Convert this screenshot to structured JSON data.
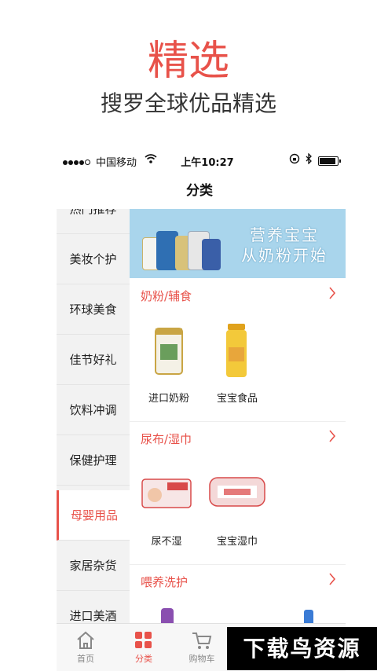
{
  "hero": {
    "title": "精选",
    "subtitle": "搜罗全球优品精选"
  },
  "status_bar": {
    "carrier": "中国移动",
    "time": "上午10:27"
  },
  "nav": {
    "title": "分类"
  },
  "sidebar": {
    "items": [
      {
        "label": "热门推荐"
      },
      {
        "label": "美妆个护"
      },
      {
        "label": "环球美食"
      },
      {
        "label": "佳节好礼"
      },
      {
        "label": "饮料冲调"
      },
      {
        "label": "保健护理"
      },
      {
        "label": "母婴用品",
        "active": true
      },
      {
        "label": "家居杂货"
      },
      {
        "label": "进口美酒"
      }
    ]
  },
  "banner": {
    "line1": "营养宝宝",
    "line2": "从奶粉开始"
  },
  "sections": [
    {
      "title": "奶粉/辅食",
      "products": [
        {
          "label": "进口奶粉"
        },
        {
          "label": "宝宝食品"
        }
      ]
    },
    {
      "title": "尿布/湿巾",
      "products": [
        {
          "label": "尿不湿"
        },
        {
          "label": "宝宝湿巾"
        }
      ]
    },
    {
      "title": "喂养洗护",
      "products": []
    }
  ],
  "tabbar": {
    "tabs": [
      {
        "label": "首页",
        "icon": "home-icon"
      },
      {
        "label": "分类",
        "icon": "category-icon",
        "active": true
      },
      {
        "label": "购物车",
        "icon": "cart-icon"
      }
    ]
  },
  "watermark": {
    "text": "下载鸟资源"
  },
  "colors": {
    "accent": "#e8524a",
    "sidebar_bg": "#f2f2f2",
    "banner_bg": "#a9d5ec"
  }
}
